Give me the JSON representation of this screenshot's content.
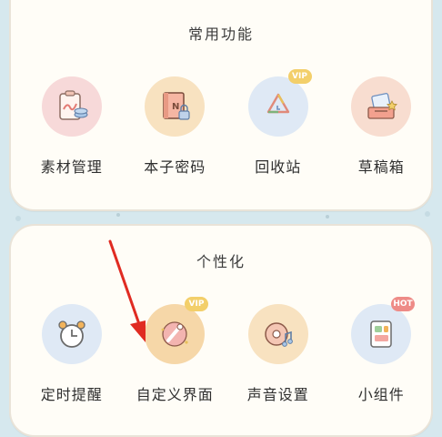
{
  "common": {
    "title": "常用功能",
    "items": [
      {
        "label": "素材管理"
      },
      {
        "label": "本子密码"
      },
      {
        "label": "回收站",
        "badge": "VIP"
      },
      {
        "label": "草稿箱"
      }
    ]
  },
  "personal": {
    "title": "个性化",
    "items": [
      {
        "label": "定时提醒"
      },
      {
        "label": "自定义界面",
        "badge": "VIP"
      },
      {
        "label": "声音设置"
      },
      {
        "label": "小组件",
        "badge": "HOT"
      }
    ]
  },
  "colors": {
    "background": "#d6e8ee",
    "card": "#fffdf7",
    "vip_badge": "#f3cf6a",
    "hot_badge": "#ee8b87",
    "arrow": "#e02b22"
  }
}
